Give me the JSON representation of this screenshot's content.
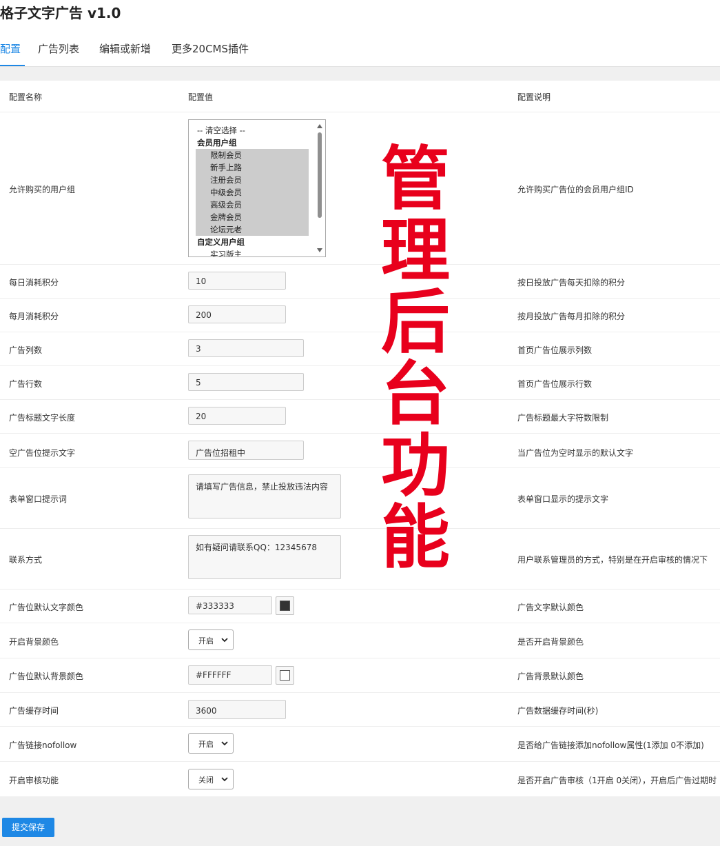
{
  "app": {
    "title": "格子文字广告 v1.0"
  },
  "tabs": [
    "配置",
    "广告列表",
    "编辑或新增",
    "更多20CMS插件"
  ],
  "table": {
    "headers": {
      "name": "配置名称",
      "value": "配置值",
      "desc": "配置说明"
    }
  },
  "user_groups": {
    "name": "允许购买的用户组",
    "desc": "允许购买广告位的会员用户组ID",
    "options": [
      {
        "label": "-- 清空选择 --",
        "kind": "clear"
      },
      {
        "label": "会员用户组",
        "kind": "group"
      },
      {
        "label": "限制会员",
        "kind": "option",
        "selected": true
      },
      {
        "label": "新手上路",
        "kind": "option",
        "selected": true
      },
      {
        "label": "注册会员",
        "kind": "option",
        "selected": true
      },
      {
        "label": "中级会员",
        "kind": "option",
        "selected": true
      },
      {
        "label": "高级会员",
        "kind": "option",
        "selected": true
      },
      {
        "label": "金牌会员",
        "kind": "option",
        "selected": true
      },
      {
        "label": "论坛元老",
        "kind": "option",
        "selected": true
      },
      {
        "label": "自定义用户组",
        "kind": "group"
      },
      {
        "label": "实习版主",
        "kind": "option",
        "selected": false
      }
    ]
  },
  "rows": {
    "daily_points": {
      "name": "每日消耗积分",
      "value": "10",
      "desc": "按日投放广告每天扣除的积分"
    },
    "monthly_points": {
      "name": "每月消耗积分",
      "value": "200",
      "desc": "按月投放广告每月扣除的积分"
    },
    "columns": {
      "name": "广告列数",
      "value": "3",
      "desc": "首页广告位展示列数"
    },
    "rows_count": {
      "name": "广告行数",
      "value": "5",
      "desc": "首页广告位展示行数"
    },
    "title_length": {
      "name": "广告标题文字长度",
      "value": "20",
      "desc": "广告标题最大字符数限制"
    },
    "empty_text": {
      "name": "空广告位提示文字",
      "value": "广告位招租中",
      "desc": "当广告位为空时显示的默认文字"
    },
    "form_tip": {
      "name": "表单窗口提示词",
      "value": "请填写广告信息，禁止投放违法内容",
      "desc": "表单窗口显示的提示文字"
    },
    "contact": {
      "name": "联系方式",
      "value": "如有疑问请联系QQ：12345678",
      "desc": "用户联系管理员的方式，特别是在开启审核的情况下"
    },
    "text_color": {
      "name": "广告位默认文字颜色",
      "value": "#333333",
      "desc": "广告文字默认颜色",
      "swatch": "#333333"
    },
    "bg_enable": {
      "name": "开启背景颜色",
      "value": "开启",
      "desc": "是否开启背景颜色"
    },
    "bg_color": {
      "name": "广告位默认背景颜色",
      "value": "#FFFFFF",
      "desc": "广告背景默认颜色",
      "swatch": "#FFFFFF"
    },
    "cache_time": {
      "name": "广告缓存时间",
      "value": "3600",
      "desc": "广告数据缓存时间(秒)"
    },
    "nofollow": {
      "name": "广告链接nofollow",
      "value": "开启",
      "desc": "是否给广告链接添加nofollow属性(1添加 0不添加)"
    },
    "review": {
      "name": "开启审核功能",
      "value": "关闭",
      "desc": "是否开启广告审核（1开启 0关闭），开启后广告过期时"
    }
  },
  "submit": {
    "label": "提交保存"
  },
  "watermark": {
    "text": "管理后台功能"
  },
  "colors": {
    "accent": "#1e88e5",
    "watermark": "#e8001c"
  }
}
